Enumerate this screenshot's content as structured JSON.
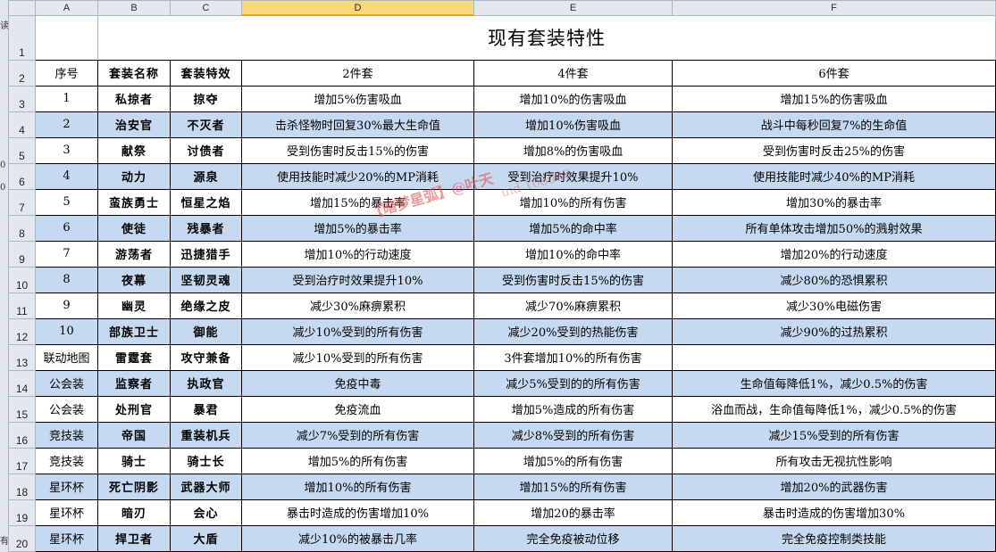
{
  "columns": [
    "A",
    "B",
    "C",
    "D",
    "E",
    "F"
  ],
  "selected_column": "D",
  "row_numbers": [
    "1",
    "2",
    "3",
    "4",
    "5",
    "6",
    "7",
    "8",
    "9",
    "10",
    "11",
    "12",
    "13",
    "14",
    "15",
    "16",
    "17",
    "18",
    "19",
    "20"
  ],
  "title": "现有套装特性",
  "headers": [
    "序号",
    "套装名称",
    "套装特效",
    "2件套",
    "4件套",
    "6件套"
  ],
  "rows": [
    {
      "no": "1",
      "name": "私掠者",
      "effect": "掠夺",
      "p2": "增加5%伤害吸血",
      "p4": "增加10%的伤害吸血",
      "p6": "增加15%的伤害吸血",
      "blue": false
    },
    {
      "no": "2",
      "name": "治安官",
      "effect": "不灭者",
      "p2": "击杀怪物时回复30%最大生命值",
      "p4": "增加10%伤害吸血",
      "p6": "战斗中每秒回复7%的生命值",
      "blue": true
    },
    {
      "no": "3",
      "name": "献祭",
      "effect": "讨债者",
      "p2": "受到伤害时反击15%的伤害",
      "p4": "增加8%的伤害吸血",
      "p6": "受到伤害时反击25%的伤害",
      "blue": false
    },
    {
      "no": "4",
      "name": "动力",
      "effect": "源泉",
      "p2": "使用技能时减少20%的MP消耗",
      "p4": "受到治疗时效果提升10%",
      "p6": "使用技能时减少40%的MP消耗",
      "blue": true
    },
    {
      "no": "5",
      "name": "蛮族勇士",
      "effect": "恒星之焰",
      "p2": "增加15%的暴击率",
      "p4": "增加10%的所有伤害",
      "p6": "增加30%的暴击率",
      "blue": false
    },
    {
      "no": "6",
      "name": "使徒",
      "effect": "残暴者",
      "p2": "增加5%的暴击率",
      "p4": "增加5%的命中率",
      "p6": "所有单体攻击增加50%的溅射效果",
      "blue": true
    },
    {
      "no": "7",
      "name": "游荡者",
      "effect": "迅捷猎手",
      "p2": "增加10%的行动速度",
      "p4": "增加10%的命中率",
      "p6": "增加20%的行动速度",
      "blue": false
    },
    {
      "no": "8",
      "name": "夜幕",
      "effect": "坚韧灵魂",
      "p2": "受到治疗时效果提升10%",
      "p4": "受到伤害时反击15%的伤害",
      "p6": "减少80%的恐惧累积",
      "blue": true
    },
    {
      "no": "9",
      "name": "幽灵",
      "effect": "绝缘之皮",
      "p2": "减少30%麻痹累积",
      "p4": "减少70%麻痹累积",
      "p6": "减少30%电磁伤害",
      "blue": false
    },
    {
      "no": "10",
      "name": "部族卫士",
      "effect": "御能",
      "p2": "减少10%受到的所有伤害",
      "p4": "减少20%受到的热能伤害",
      "p6": "减少90%的过热累积",
      "blue": true
    },
    {
      "no": "联动地图",
      "name": "雷霆套",
      "effect": "攻守兼备",
      "p2": "减少10%受到的所有伤害",
      "p4": "3件套增加10%的所有伤害",
      "p6": "",
      "blue": false
    },
    {
      "no": "公会装",
      "name": "监察者",
      "effect": "执政官",
      "p2": "免疫中毒",
      "p4": "减少5%受到的的所有伤害",
      "p6": "生命值每降低1%，减少0.5%的伤害",
      "blue": true
    },
    {
      "no": "公会装",
      "name": "处刑官",
      "effect": "暴君",
      "p2": "免疫流血",
      "p4": "增加5%造成的所有伤害",
      "p6": "浴血而战，生命值每降低1%，减少0.5%的伤害",
      "blue": false
    },
    {
      "no": "竞技装",
      "name": "帝国",
      "effect": "重装机兵",
      "p2": "减少7%受到的所有伤害",
      "p4": "减少8%受到的所有伤害",
      "p6": "减少15%受到的所有伤害",
      "blue": true
    },
    {
      "no": "竞技装",
      "name": "骑士",
      "effect": "骑士长",
      "p2": "增加5%的所有伤害",
      "p4": "增加5%的所有伤害",
      "p6": "所有攻击无视抗性影响",
      "blue": false
    },
    {
      "no": "星环杯",
      "name": "死亡阴影",
      "effect": "武器大师",
      "p2": "增加10%的所有伤害",
      "p4": "增加15%的所有伤害",
      "p6": "增加20%的武器伤害",
      "blue": true
    },
    {
      "no": "星环杯",
      "name": "暗刃",
      "effect": "会心",
      "p2": "暴击时造成的伤害增加10%",
      "p4": "增加20的暴击率",
      "p6": "暴击时造成的伤害增加30%",
      "blue": false
    },
    {
      "no": "星环杯",
      "name": "捍卫者",
      "effect": "大盾",
      "p2": "减少10%的被暴击几率",
      "p4": "完全免疫被动位移",
      "p6": "完全免疫控制类技能",
      "blue": true
    }
  ],
  "watermark": "【暗梦星弧】@叶天",
  "watermark2": "uid 108088",
  "left_strip_text": [
    "读",
    "0",
    "0",
    "有"
  ]
}
